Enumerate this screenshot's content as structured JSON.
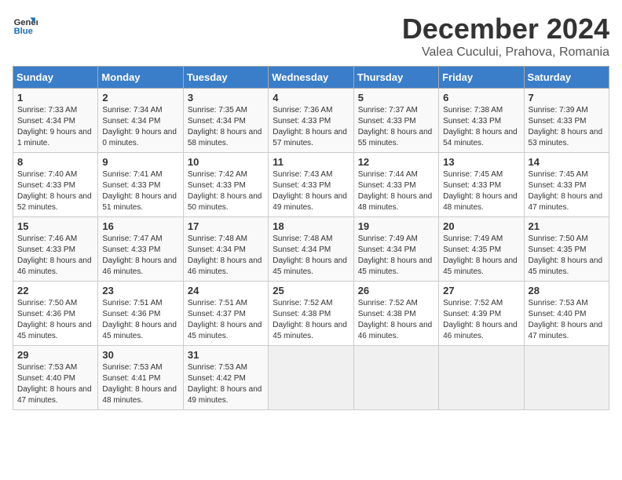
{
  "logo": {
    "line1": "General",
    "line2": "Blue"
  },
  "title": "December 2024",
  "subtitle": "Valea Cucului, Prahova, Romania",
  "days_of_week": [
    "Sunday",
    "Monday",
    "Tuesday",
    "Wednesday",
    "Thursday",
    "Friday",
    "Saturday"
  ],
  "weeks": [
    [
      {
        "day": "1",
        "sunrise": "7:33 AM",
        "sunset": "4:34 PM",
        "daylight": "9 hours and 1 minute."
      },
      {
        "day": "2",
        "sunrise": "7:34 AM",
        "sunset": "4:34 PM",
        "daylight": "9 hours and 0 minutes."
      },
      {
        "day": "3",
        "sunrise": "7:35 AM",
        "sunset": "4:34 PM",
        "daylight": "8 hours and 58 minutes."
      },
      {
        "day": "4",
        "sunrise": "7:36 AM",
        "sunset": "4:33 PM",
        "daylight": "8 hours and 57 minutes."
      },
      {
        "day": "5",
        "sunrise": "7:37 AM",
        "sunset": "4:33 PM",
        "daylight": "8 hours and 55 minutes."
      },
      {
        "day": "6",
        "sunrise": "7:38 AM",
        "sunset": "4:33 PM",
        "daylight": "8 hours and 54 minutes."
      },
      {
        "day": "7",
        "sunrise": "7:39 AM",
        "sunset": "4:33 PM",
        "daylight": "8 hours and 53 minutes."
      }
    ],
    [
      {
        "day": "8",
        "sunrise": "7:40 AM",
        "sunset": "4:33 PM",
        "daylight": "8 hours and 52 minutes."
      },
      {
        "day": "9",
        "sunrise": "7:41 AM",
        "sunset": "4:33 PM",
        "daylight": "8 hours and 51 minutes."
      },
      {
        "day": "10",
        "sunrise": "7:42 AM",
        "sunset": "4:33 PM",
        "daylight": "8 hours and 50 minutes."
      },
      {
        "day": "11",
        "sunrise": "7:43 AM",
        "sunset": "4:33 PM",
        "daylight": "8 hours and 49 minutes."
      },
      {
        "day": "12",
        "sunrise": "7:44 AM",
        "sunset": "4:33 PM",
        "daylight": "8 hours and 48 minutes."
      },
      {
        "day": "13",
        "sunrise": "7:45 AM",
        "sunset": "4:33 PM",
        "daylight": "8 hours and 48 minutes."
      },
      {
        "day": "14",
        "sunrise": "7:45 AM",
        "sunset": "4:33 PM",
        "daylight": "8 hours and 47 minutes."
      }
    ],
    [
      {
        "day": "15",
        "sunrise": "7:46 AM",
        "sunset": "4:33 PM",
        "daylight": "8 hours and 46 minutes."
      },
      {
        "day": "16",
        "sunrise": "7:47 AM",
        "sunset": "4:33 PM",
        "daylight": "8 hours and 46 minutes."
      },
      {
        "day": "17",
        "sunrise": "7:48 AM",
        "sunset": "4:34 PM",
        "daylight": "8 hours and 46 minutes."
      },
      {
        "day": "18",
        "sunrise": "7:48 AM",
        "sunset": "4:34 PM",
        "daylight": "8 hours and 45 minutes."
      },
      {
        "day": "19",
        "sunrise": "7:49 AM",
        "sunset": "4:34 PM",
        "daylight": "8 hours and 45 minutes."
      },
      {
        "day": "20",
        "sunrise": "7:49 AM",
        "sunset": "4:35 PM",
        "daylight": "8 hours and 45 minutes."
      },
      {
        "day": "21",
        "sunrise": "7:50 AM",
        "sunset": "4:35 PM",
        "daylight": "8 hours and 45 minutes."
      }
    ],
    [
      {
        "day": "22",
        "sunrise": "7:50 AM",
        "sunset": "4:36 PM",
        "daylight": "8 hours and 45 minutes."
      },
      {
        "day": "23",
        "sunrise": "7:51 AM",
        "sunset": "4:36 PM",
        "daylight": "8 hours and 45 minutes."
      },
      {
        "day": "24",
        "sunrise": "7:51 AM",
        "sunset": "4:37 PM",
        "daylight": "8 hours and 45 minutes."
      },
      {
        "day": "25",
        "sunrise": "7:52 AM",
        "sunset": "4:38 PM",
        "daylight": "8 hours and 45 minutes."
      },
      {
        "day": "26",
        "sunrise": "7:52 AM",
        "sunset": "4:38 PM",
        "daylight": "8 hours and 46 minutes."
      },
      {
        "day": "27",
        "sunrise": "7:52 AM",
        "sunset": "4:39 PM",
        "daylight": "8 hours and 46 minutes."
      },
      {
        "day": "28",
        "sunrise": "7:53 AM",
        "sunset": "4:40 PM",
        "daylight": "8 hours and 47 minutes."
      }
    ],
    [
      {
        "day": "29",
        "sunrise": "7:53 AM",
        "sunset": "4:40 PM",
        "daylight": "8 hours and 47 minutes."
      },
      {
        "day": "30",
        "sunrise": "7:53 AM",
        "sunset": "4:41 PM",
        "daylight": "8 hours and 48 minutes."
      },
      {
        "day": "31",
        "sunrise": "7:53 AM",
        "sunset": "4:42 PM",
        "daylight": "8 hours and 49 minutes."
      },
      null,
      null,
      null,
      null
    ]
  ]
}
